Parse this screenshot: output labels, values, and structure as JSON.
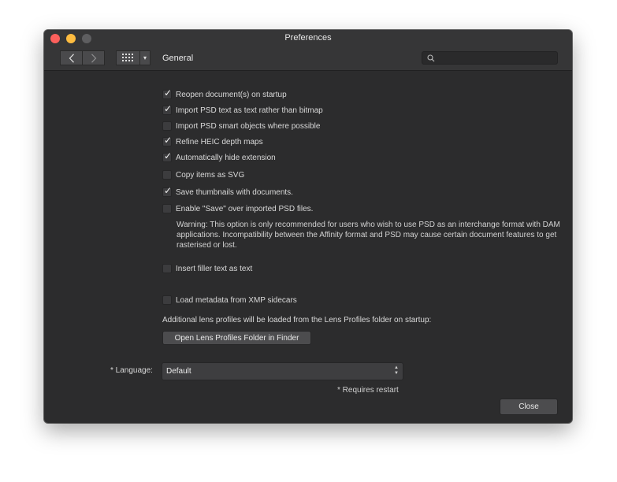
{
  "window": {
    "title": "Preferences"
  },
  "toolbar": {
    "back_icon": "chevron-left-icon",
    "forward_icon": "chevron-right-icon",
    "grid_icon": "grid-icon",
    "dropdown_glyph": "▾",
    "section_title": "General",
    "search": {
      "value": "",
      "placeholder": ""
    }
  },
  "options": [
    {
      "label": "Reopen document(s) on startup",
      "checked": true
    },
    {
      "label": "Import PSD text as text rather than bitmap",
      "checked": true
    },
    {
      "label": "Import PSD smart objects where possible",
      "checked": false
    },
    {
      "label": "Refine HEIC depth maps",
      "checked": true
    },
    {
      "label": "Automatically hide extension",
      "checked": true
    },
    {
      "label": "Copy items as SVG",
      "checked": false
    },
    {
      "label": "Save thumbnails with documents.",
      "checked": true
    },
    {
      "label": "Enable \"Save\" over imported PSD files.",
      "checked": false
    },
    {
      "label": "Insert filler text as text",
      "checked": false
    },
    {
      "label": "Load metadata from XMP sidecars",
      "checked": false
    }
  ],
  "check_glyph": "✓",
  "warning": "Warning: This option is only recommended for users who wish to use PSD as an interchange format with DAM applications. Incompatibility between the Affinity format and PSD may cause certain document features to get rasterised or lost.",
  "lens_profiles": {
    "text": "Additional lens profiles will be loaded from the Lens Profiles folder on startup:",
    "button_label": "Open Lens Profiles Folder in Finder"
  },
  "language": {
    "label": "* Language:",
    "value": "Default",
    "note": "* Requires restart"
  },
  "close_label": "Close",
  "colors": {
    "close": "#fc605c",
    "minimize": "#fdbc40",
    "zoom_disabled": "#5e5e60",
    "window_bg": "#2c2c2d"
  }
}
